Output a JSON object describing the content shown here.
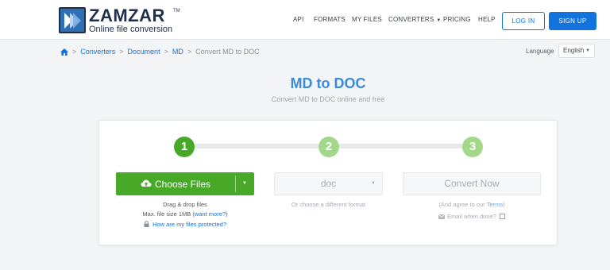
{
  "header": {
    "logo_name": "ZAMZAR",
    "logo_tm": "TM",
    "logo_tagline": "Online file conversion",
    "nav": {
      "api": "API",
      "formats": "FORMATS",
      "my_files": "MY FILES",
      "converters": "CONVERTERS",
      "pricing": "PRICING",
      "help": "HELP"
    },
    "login_label": "LOG IN",
    "signup_label": "SIGN UP"
  },
  "breadcrumb": {
    "items": [
      "Converters",
      "Document",
      "MD"
    ],
    "current": "Convert MD to DOC",
    "separator": ">"
  },
  "language": {
    "label": "Language",
    "selected": "English"
  },
  "page": {
    "title": "MD to DOC",
    "subtitle": "Convert MD to DOC online and free"
  },
  "converter": {
    "steps": [
      "1",
      "2",
      "3"
    ],
    "choose_files_label": "Choose Files",
    "drag_drop_text": "Drag & drop files",
    "max_size_text": "Max. file size 1MB",
    "want_more_link": "(want more?)",
    "protected_link": "How are my files protected?",
    "format_value": "doc",
    "format_hint": "Or choose a different format",
    "convert_label": "Convert Now",
    "terms_prefix": "(And agree to our",
    "terms_link": "Terms",
    "terms_suffix": ")",
    "email_label": "Email when done?"
  },
  "colors": {
    "brand_blue": "#1273de",
    "title_blue": "#3a8bd9",
    "active_green": "#46a826",
    "inactive_green": "#a3d88b",
    "logo_navy": "#1f2e4a"
  },
  "icons": {
    "logo": "zamzar-logo-icon",
    "home": "home-icon",
    "upload": "cloud-upload-icon",
    "lock": "lock-icon",
    "mail": "envelope-icon",
    "caret": "caret-down-icon"
  }
}
